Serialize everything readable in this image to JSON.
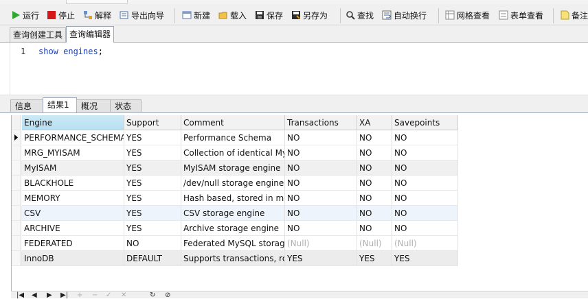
{
  "toolbar": {
    "items": [
      {
        "id": "run",
        "label": "运行",
        "icon": "play-icon"
      },
      {
        "id": "stop",
        "label": "停止",
        "icon": "stop-icon"
      },
      {
        "id": "explain",
        "label": "解释",
        "icon": "explain-icon"
      },
      {
        "id": "export",
        "label": "导出向导",
        "icon": "export-icon"
      },
      {
        "id": "new",
        "label": "新建",
        "icon": "new-icon"
      },
      {
        "id": "load",
        "label": "载入",
        "icon": "folder-icon"
      },
      {
        "id": "save",
        "label": "保存",
        "icon": "save-icon"
      },
      {
        "id": "saveas",
        "label": "另存为",
        "icon": "save-as-icon"
      },
      {
        "id": "find",
        "label": "查找",
        "icon": "search-icon"
      },
      {
        "id": "wrap",
        "label": "自动换行",
        "icon": "wrap-icon"
      },
      {
        "id": "gridview",
        "label": "网格查看",
        "icon": "grid-view-icon"
      },
      {
        "id": "formview",
        "label": "表单查看",
        "icon": "form-view-icon"
      },
      {
        "id": "note",
        "label": "备注",
        "icon": "note-icon"
      }
    ],
    "colors": {
      "play": "#2fa82f",
      "stop": "#d41818"
    }
  },
  "top_tabs": [
    {
      "label": "查询创建工具",
      "active": false
    },
    {
      "label": "查询编辑器",
      "active": true
    }
  ],
  "editor": {
    "line_number": "1",
    "code_keyword": "show engines",
    "code_terminator": ";"
  },
  "result_tabs": [
    {
      "label": "信息",
      "active": false
    },
    {
      "label": "结果1",
      "active": true
    },
    {
      "label": "概况",
      "active": false
    },
    {
      "label": "状态",
      "active": false
    }
  ],
  "grid": {
    "columns": [
      "Engine",
      "Support",
      "Comment",
      "Transactions",
      "XA",
      "Savepoints"
    ],
    "sorted_column": 0,
    "current_row": 0,
    "rows": [
      [
        "PERFORMANCE_SCHEMA",
        "YES",
        "Performance Schema",
        "NO",
        "NO",
        "NO"
      ],
      [
        "MRG_MYISAM",
        "YES",
        "Collection of identical My",
        "NO",
        "NO",
        "NO"
      ],
      [
        "MyISAM",
        "YES",
        "MyISAM storage engine",
        "NO",
        "NO",
        "NO"
      ],
      [
        "BLACKHOLE",
        "YES",
        "/dev/null storage engine",
        "NO",
        "NO",
        "NO"
      ],
      [
        "MEMORY",
        "YES",
        "Hash based, stored in me",
        "NO",
        "NO",
        "NO"
      ],
      [
        "CSV",
        "YES",
        "CSV storage engine",
        "NO",
        "NO",
        "NO"
      ],
      [
        "ARCHIVE",
        "YES",
        "Archive storage engine",
        "NO",
        "NO",
        "NO"
      ],
      [
        "FEDERATED",
        "NO",
        "Federated MySQL storag",
        "(Null)",
        "(Null)",
        "(Null)"
      ],
      [
        "InnoDB",
        "DEFAULT",
        "Supports transactions, ro",
        "YES",
        "YES",
        "YES"
      ]
    ],
    "row_colors": [
      "#ffffff",
      "#ffffff",
      "#f0f0f0",
      "#ffffff",
      "#ffffff",
      "#eef4fb",
      "#ffffff",
      "#ffffff",
      "#ececec"
    ]
  },
  "navbar": {
    "buttons": [
      {
        "name": "first-record-icon",
        "glyph": "|◀",
        "enabled": true
      },
      {
        "name": "previous-record-icon",
        "glyph": "◀",
        "enabled": true
      },
      {
        "name": "next-record-icon",
        "glyph": "▶",
        "enabled": true
      },
      {
        "name": "last-record-icon",
        "glyph": "▶|",
        "enabled": true
      },
      {
        "name": "add-record-icon",
        "glyph": "+",
        "enabled": false
      },
      {
        "name": "delete-record-icon",
        "glyph": "−",
        "enabled": false
      },
      {
        "name": "apply-icon",
        "glyph": "✓",
        "enabled": false
      },
      {
        "name": "cancel-icon",
        "glyph": "✕",
        "enabled": false
      },
      {
        "name": "refresh-icon",
        "glyph": "↻",
        "enabled": true
      },
      {
        "name": "stop-refresh-icon",
        "glyph": "⊘",
        "enabled": true
      }
    ]
  }
}
